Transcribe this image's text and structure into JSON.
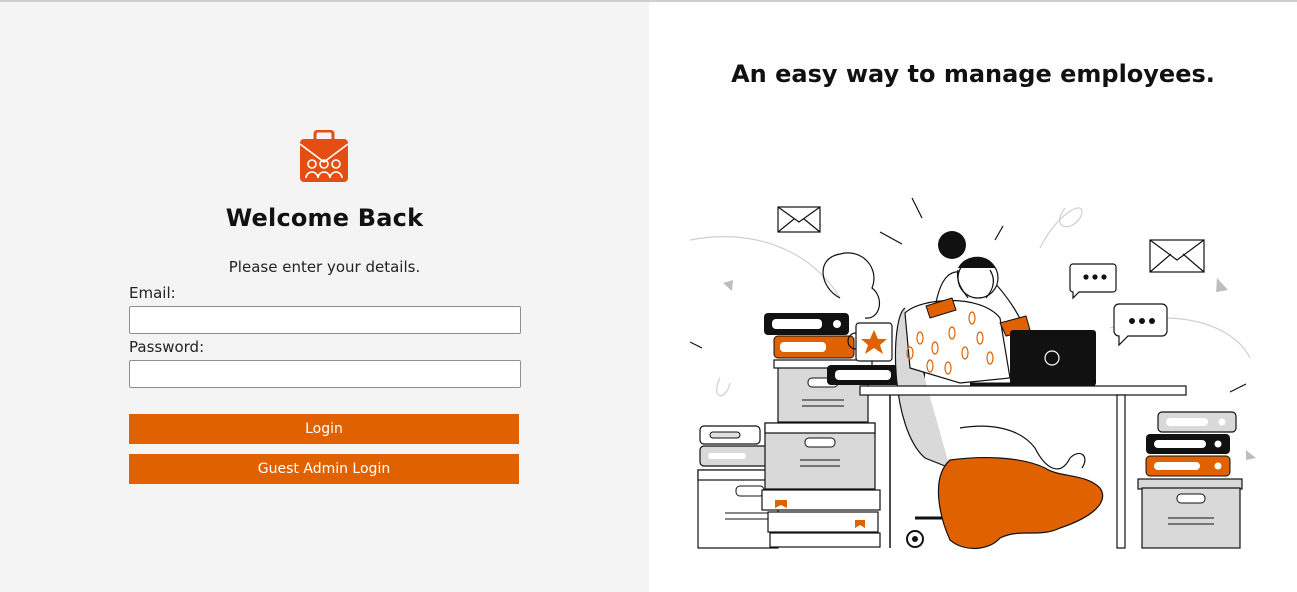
{
  "login": {
    "title": "Welcome Back",
    "subtitle": "Please enter your details.",
    "email_label": "Email:",
    "email_value": "",
    "password_label": "Password:",
    "password_value": "",
    "login_button": "Login",
    "guest_button": "Guest Admin Login",
    "logo_icon": "briefcase-team-icon"
  },
  "hero": {
    "headline": "An easy way to manage employees.",
    "illustration": "stressed-employee-desk-illustration"
  },
  "colors": {
    "accent": "#e06100",
    "left_panel_bg": "#f4f4f4",
    "right_panel_bg": "#ffffff"
  }
}
